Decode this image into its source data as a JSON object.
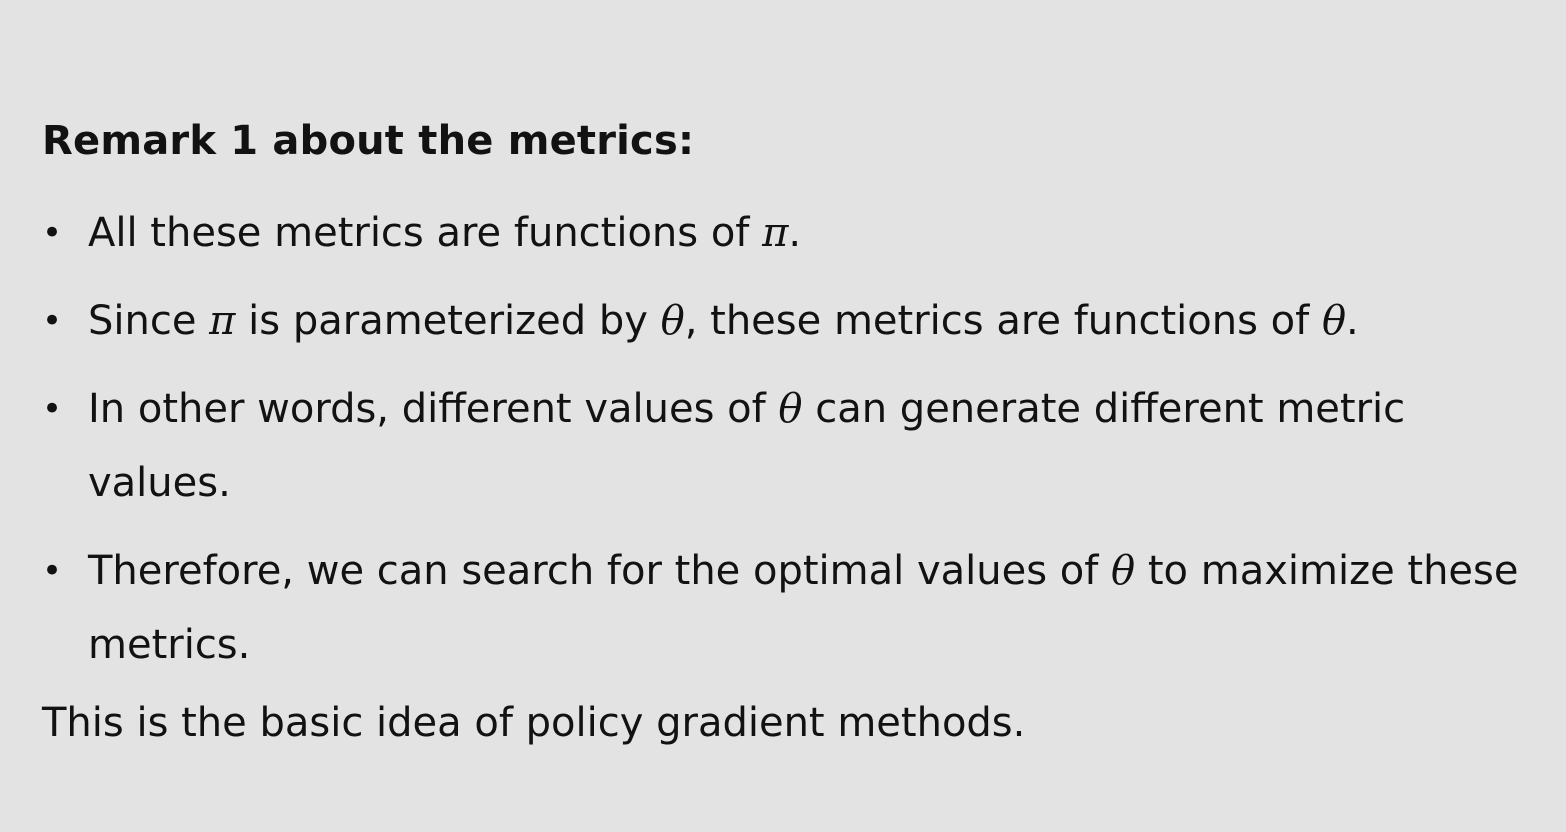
{
  "heading": "Remark 1 about the metrics:",
  "bullets": [
    {
      "parts": [
        "All these metrics are functions of ",
        "π",
        "."
      ]
    },
    {
      "parts": [
        "Since ",
        "π",
        " is parameterized by ",
        "θ",
        ", these metrics are functions of ",
        "θ",
        "."
      ]
    },
    {
      "parts": [
        "In other words, different values of ",
        "θ",
        " can generate different metric\nvalues."
      ]
    },
    {
      "parts": [
        "Therefore, we can search for the optimal values of ",
        "θ",
        " to maximize these\nmetrics."
      ]
    }
  ],
  "bullet_symbol": "•",
  "closing": "This is the basic idea of policy gradient methods."
}
